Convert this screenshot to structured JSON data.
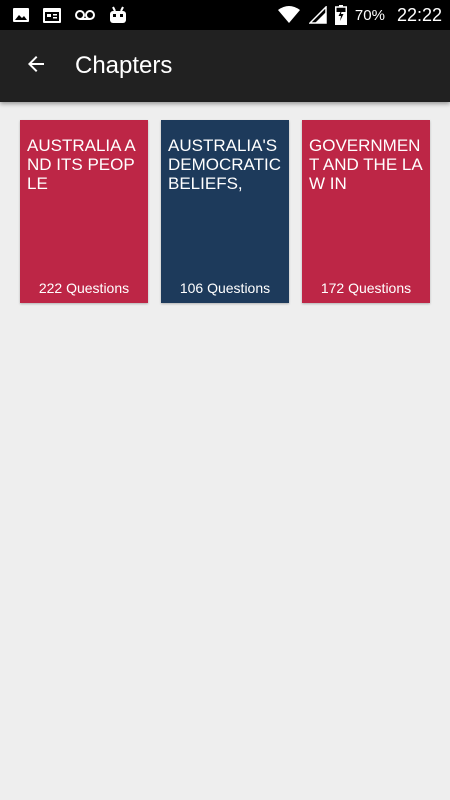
{
  "status_bar": {
    "battery_percent": "70%",
    "time": "22:22",
    "icons": [
      "image-icon",
      "calendar-icon",
      "voicemail-icon",
      "android-debug-icon",
      "wifi-icon",
      "signal-icon",
      "battery-charging-icon"
    ]
  },
  "app_bar": {
    "back_icon": "arrow-left-icon",
    "title": "Chapters"
  },
  "chapters": [
    {
      "title": "AUSTRALIA AND ITS PEOPLE",
      "count_label": "222 Questions",
      "color": "#bd2646"
    },
    {
      "title": "AUSTRALIA'S DEMOCRATIC BELIEFS,",
      "count_label": "106 Questions",
      "color": "#1d3a5b"
    },
    {
      "title": "GOVERNMENT AND THE LAW IN",
      "count_label": "172 Questions",
      "color": "#bd2646"
    }
  ],
  "colors": {
    "status_bar": "#000000",
    "app_bar": "#212121",
    "background": "#eeeeee"
  }
}
